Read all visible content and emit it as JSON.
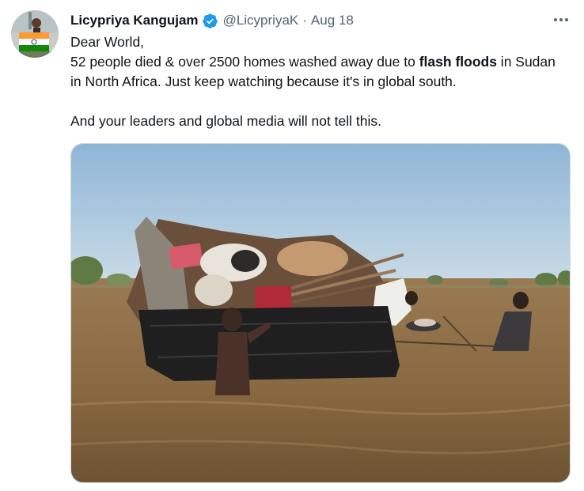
{
  "tweet": {
    "display_name": "Licypriya Kangujam",
    "handle": "@LicypriyaK",
    "separator": "·",
    "timestamp": "Aug 18",
    "text": {
      "line1": "Dear World,",
      "line2_before": "52 people died & over 2500 homes washed away due to ",
      "line2_bold": "flash floods",
      "line2_after": " in Sudan in North Africa. Just keep watching because it's in global south.",
      "line3": "And your leaders and global media will not tell this."
    }
  },
  "icons": {
    "verified": "verified-badge-icon",
    "more": "more-options-icon"
  },
  "colors": {
    "text": "#0f1419",
    "secondary": "#536471",
    "verified": "#1d9bf0",
    "border": "#cfd9de"
  }
}
